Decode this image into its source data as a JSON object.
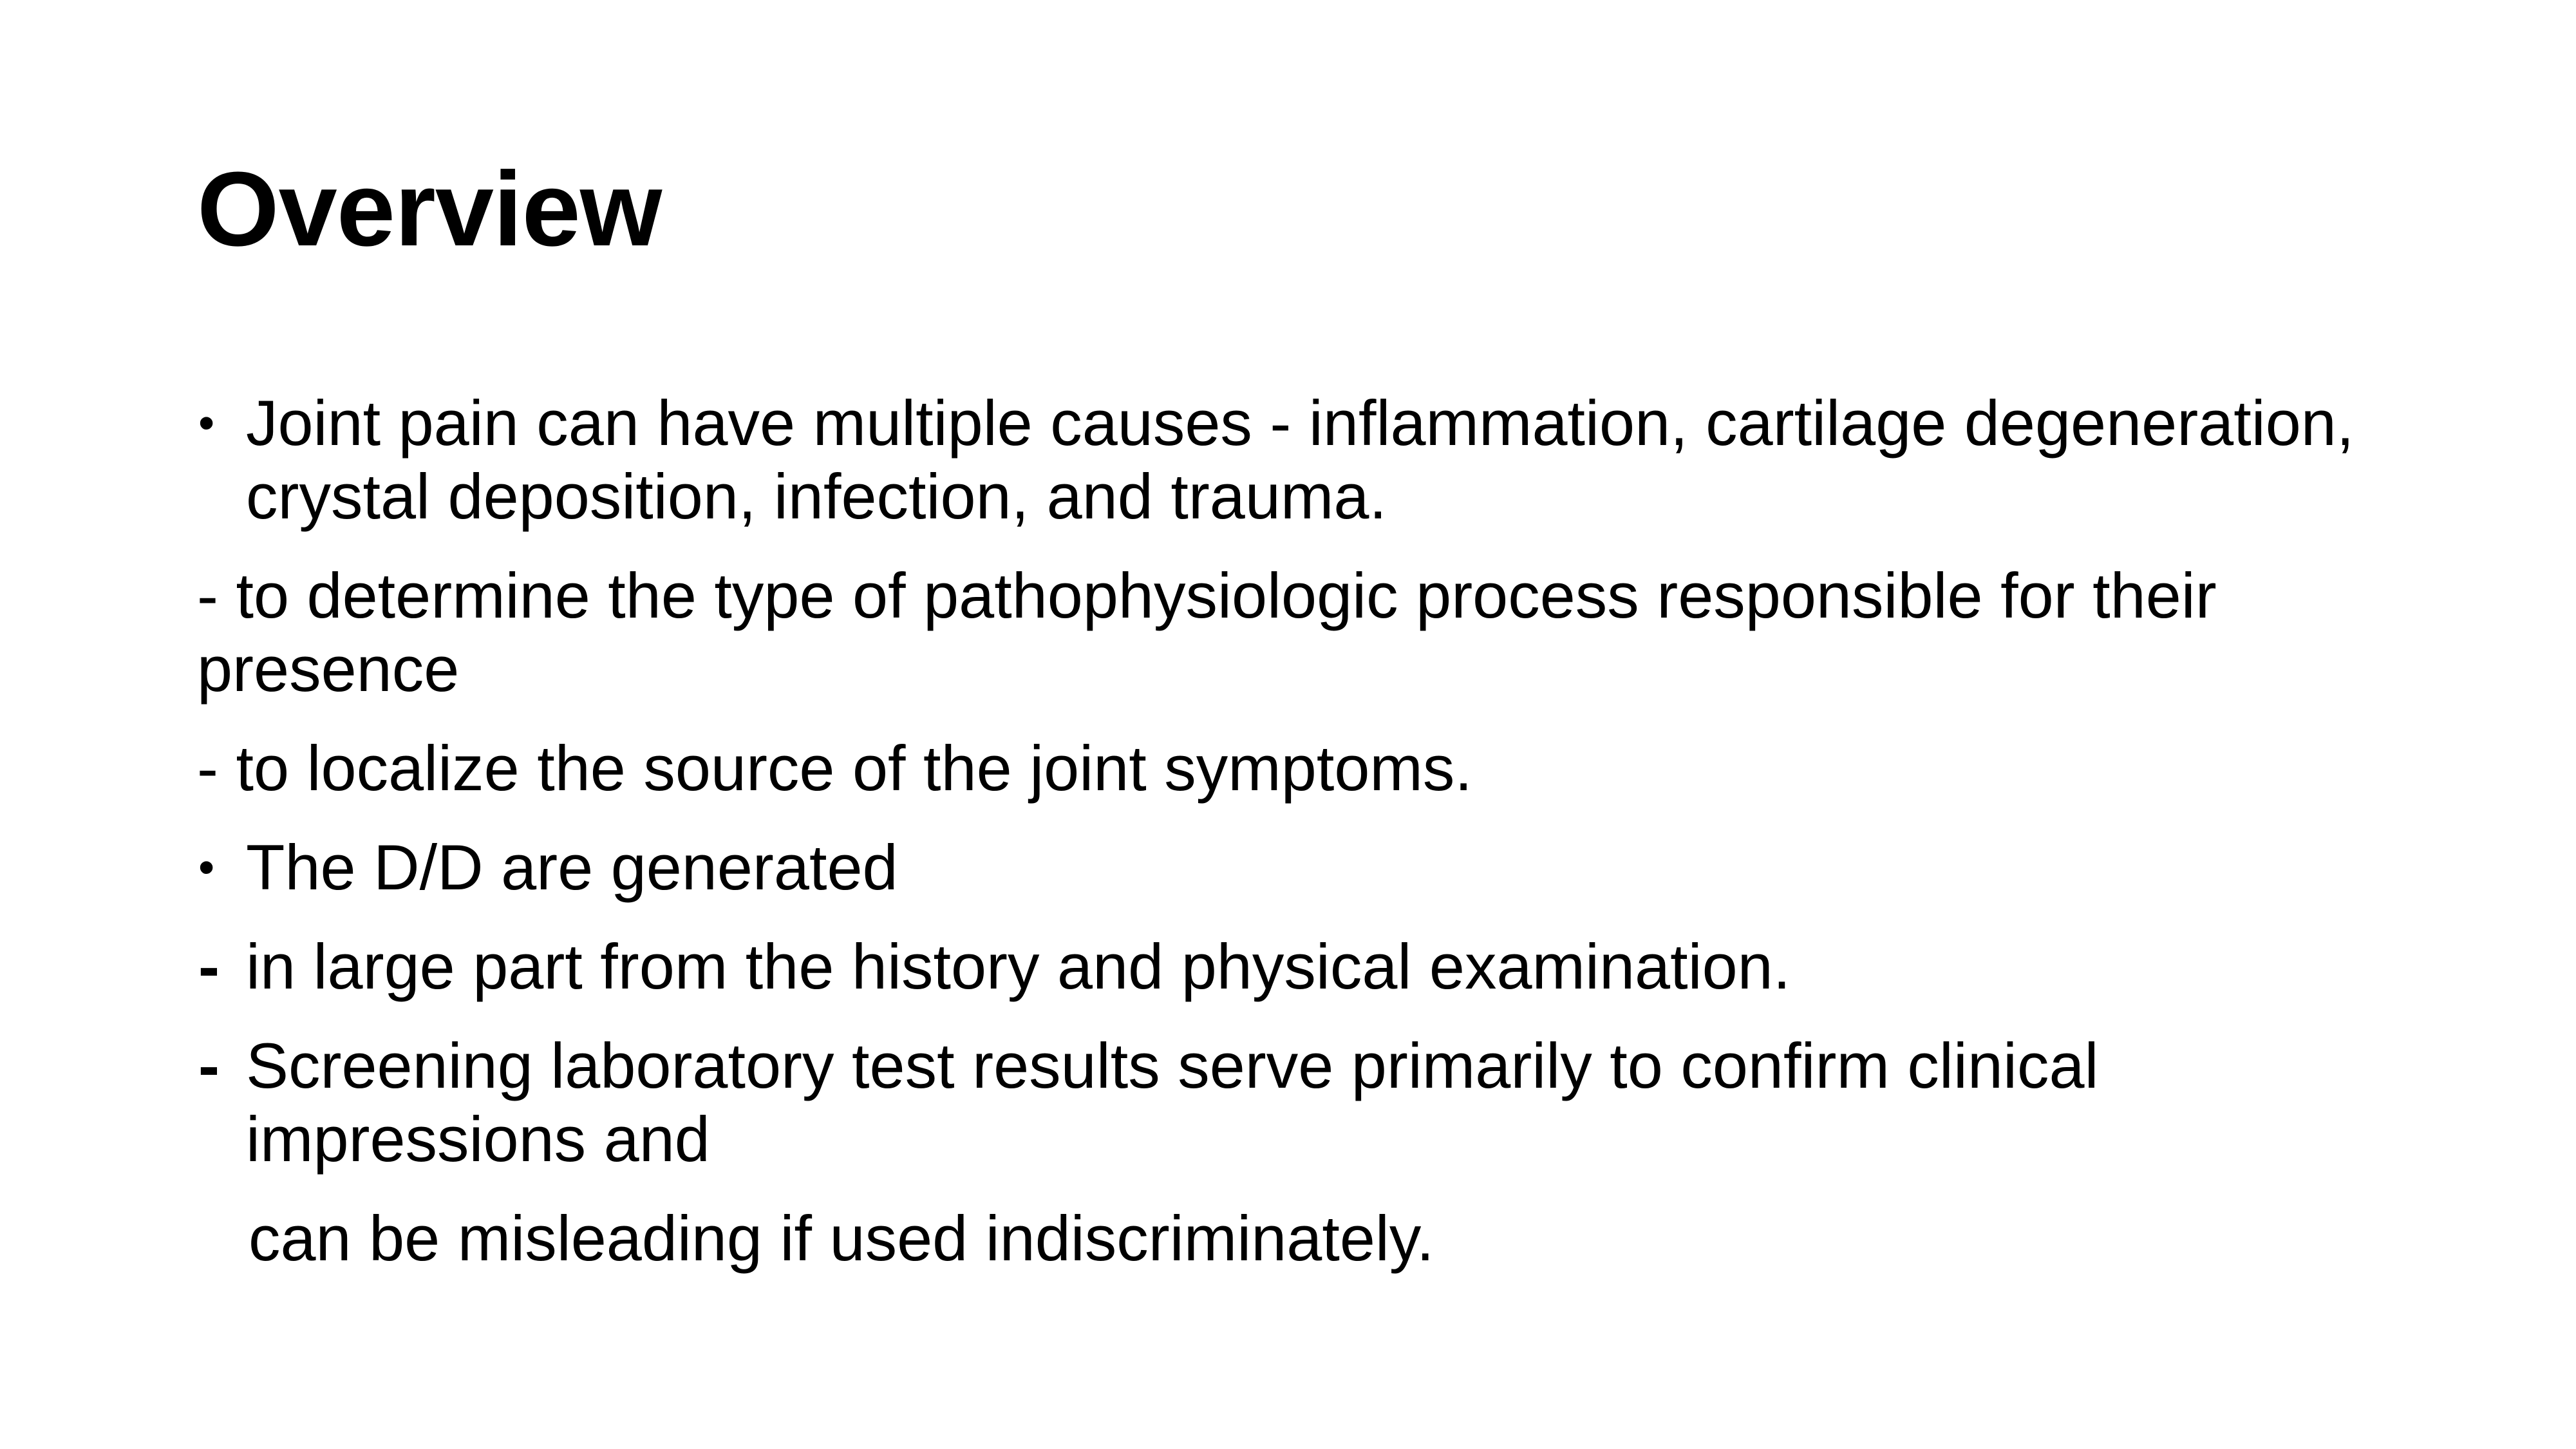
{
  "slide": {
    "title": "Overview",
    "items": [
      {
        "marker": "•",
        "text": "Joint pain can have multiple causes - inflammation, cartilage degeneration, crystal deposition, infection, and trauma."
      },
      {
        "marker": "",
        "text": "- to determine the type of pathophysiologic process responsible for their presence"
      },
      {
        "marker": "",
        "text": "- to localize the source of the joint symptoms."
      },
      {
        "marker": "•",
        "text": "The D/D are generated"
      },
      {
        "marker": "-",
        "text": "in large part from the history and physical examination."
      },
      {
        "marker": "-",
        "text": "Screening laboratory test results serve primarily to confirm clinical impressions and"
      },
      {
        "marker": "",
        "text": "can be misleading if used indiscriminately."
      }
    ]
  }
}
